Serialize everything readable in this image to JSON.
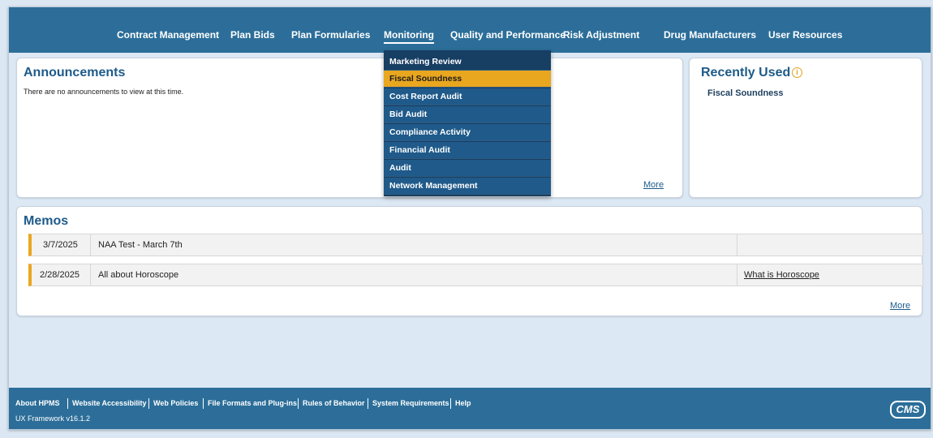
{
  "nav": {
    "items": [
      "Contract Management",
      "Plan Bids",
      "Plan Formularies",
      "Monitoring",
      "Quality and Performance",
      "Risk Adjustment",
      "Drug Manufacturers",
      "User Resources"
    ],
    "active": "Monitoring"
  },
  "dropdown": {
    "items": [
      "Marketing Review",
      "Fiscal Soundness",
      "Cost Report Audit",
      "Bid Audit",
      "Compliance Activity",
      "Financial Audit",
      "Audit",
      "Network Management"
    ],
    "highlighted": "Fiscal Soundness"
  },
  "announcements": {
    "title": "Announcements",
    "empty_text": "There are no announcements to view at this time.",
    "more_label": "More"
  },
  "recently_used": {
    "title": "Recently Used",
    "items": [
      "Fiscal Soundness"
    ]
  },
  "memos": {
    "title": "Memos",
    "rows": [
      {
        "date": "3/7/2025",
        "title": "NAA Test - March 7th",
        "link": ""
      },
      {
        "date": "2/28/2025",
        "title": "All about Horoscope",
        "link": "What is Horoscope"
      }
    ],
    "more_label": "More"
  },
  "footer": {
    "links": [
      "About HPMS",
      "Website Accessibility",
      "Web Policies",
      "File Formats and Plug-ins",
      "Rules of Behavior",
      "System Requirements",
      "Help"
    ],
    "version": "UX Framework v16.1.2",
    "logo_text": "CMS"
  },
  "colors": {
    "nav_bg": "#2c6e99",
    "dropdown_bg": "#173e63",
    "highlight": "#e9a61f",
    "title_blue": "#1d5b8a"
  }
}
